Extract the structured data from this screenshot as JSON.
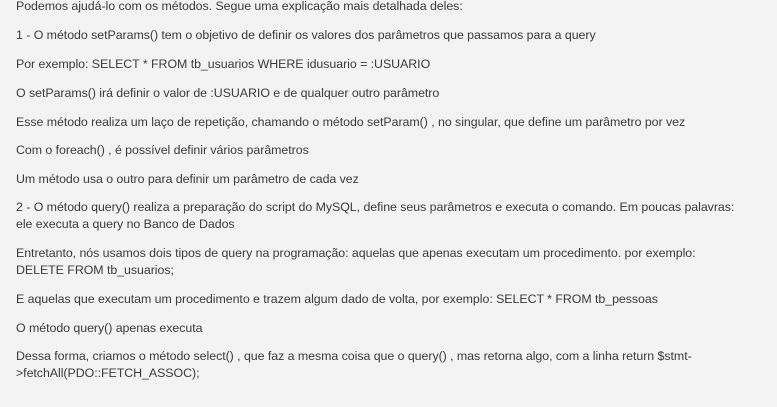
{
  "post": {
    "paragraphs": [
      "Podemos ajudá-lo com os métodos. Segue uma explicação mais detalhada deles:",
      "1 - O método setParams() tem o objetivo de definir os valores dos parâmetros que passamos para a query",
      "Por exemplo: SELECT * FROM tb_usuarios WHERE idusuario = :USUARIO",
      "O setParams() irá definir o valor de :USUARIO e de qualquer outro parâmetro",
      "Esse método realiza um laço de repetição, chamando o método setParam() , no singular, que define um parâmetro por vez",
      "Com o foreach() , é possível definir vários parâmetros",
      "Um método usa o outro para definir um parâmetro de cada vez",
      "2 - O método query() realiza a preparação do script do MySQL, define seus parâmetros e executa o comando. Em poucas palavras:\nele executa a query no Banco de Dados",
      "Entretanto, nós usamos dois tipos de query na programação: aquelas que apenas executam um procedimento. por exemplo:\nDELETE FROM tb_usuarios;",
      "E aquelas que executam um procedimento e trazem algum dado de volta, por exemplo: SELECT * FROM tb_pessoas",
      "O método query() apenas executa",
      "Dessa forma, criamos o método select() , que faz a mesma coisa que o query() , mas retorna algo, com a linha return $stmt-\n>fetchAll(PDO::FETCH_ASSOC);"
    ]
  }
}
